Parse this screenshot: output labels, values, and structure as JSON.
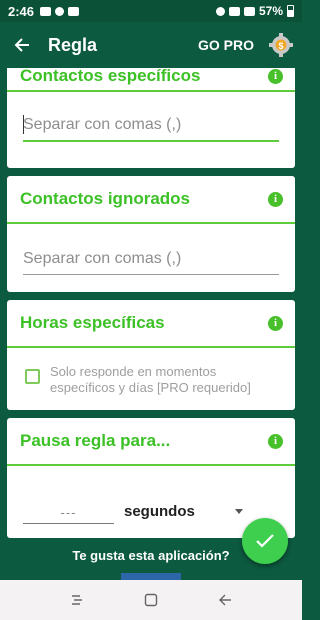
{
  "status_bar": {
    "time": "2:46",
    "battery": "57%"
  },
  "app_bar": {
    "title": "Regla",
    "go_pro": "GO PRO"
  },
  "cards": {
    "specific_contacts": {
      "title": "Contactos específicos",
      "placeholder": "Separar con comas (,)",
      "value": ""
    },
    "ignored_contacts": {
      "title": "Contactos ignorados",
      "placeholder": "Separar con comas (,)",
      "value": ""
    },
    "specific_hours": {
      "title": "Horas específicas",
      "checkbox_label": "Solo responde en momentos específicos y días [PRO requerido]",
      "checked": false
    },
    "pause_rule": {
      "title": "Pausa regla para...",
      "value": "---",
      "unit": "segundos"
    }
  },
  "footer": {
    "prompt": "Te gusta esta aplicación?"
  },
  "icons": {
    "info": "info-icon",
    "gear": "gear-icon",
    "back": "back-arrow-icon",
    "fab": "check-icon"
  },
  "colors": {
    "primary": "#0c5a3f",
    "accent": "#3cc126",
    "fab": "#3ecf4f"
  }
}
